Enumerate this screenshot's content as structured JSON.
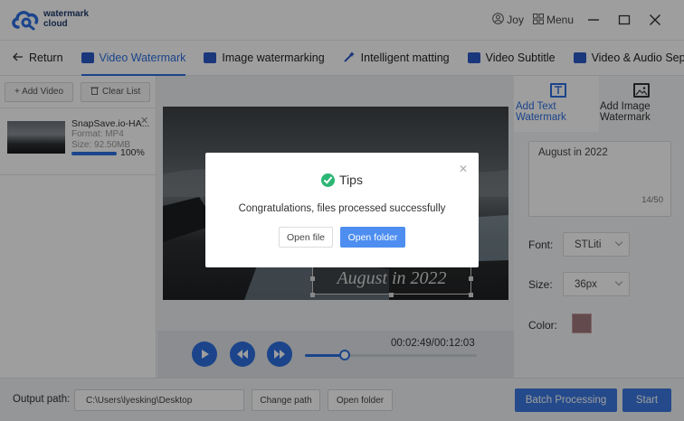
{
  "app": {
    "logo_line1": "watermark",
    "logo_line2": "cloud",
    "user": "Joy",
    "menu": "Menu"
  },
  "nav": {
    "return": "Return",
    "tabs": [
      {
        "label": "Video Watermark"
      },
      {
        "label": "Image watermarking"
      },
      {
        "label": "Intelligent matting"
      },
      {
        "label": "Video Subtitle"
      },
      {
        "label": "Video & Audio Sepa"
      }
    ]
  },
  "left": {
    "add_video": "+ Add Video",
    "clear_list": "Clear List",
    "file": {
      "name": "SnapSave.io-HA...",
      "format": "Format:  MP4",
      "size": "Size:  92.50MB",
      "progress": "100%",
      "progress_value": 1.0
    }
  },
  "player": {
    "watermark_text": "August in 2022",
    "time": "00:02:49/00:12:03",
    "seek_fraction": 0.234
  },
  "right": {
    "tab_text": [
      "Add Text",
      "Watermark"
    ],
    "tab_image": [
      "Add Image",
      "Watermark"
    ],
    "text_value": "August in 2022",
    "char_count": "14/50",
    "font_label": "Font:",
    "font_value": "STLiti",
    "size_label": "Size:",
    "size_value": "36px",
    "color_label": "Color:",
    "color_value": "#a07a7c"
  },
  "bottom": {
    "output_label": "Output path:",
    "output_path": "C:\\Users\\lyesking\\Desktop",
    "change_path": "Change path",
    "open_folder": "Open folder",
    "batch": "Batch Processing",
    "start": "Start"
  },
  "dialog": {
    "title": "Tips",
    "message": "Congratulations, files processed successfully",
    "open_file": "Open file",
    "open_folder": "Open folder"
  }
}
